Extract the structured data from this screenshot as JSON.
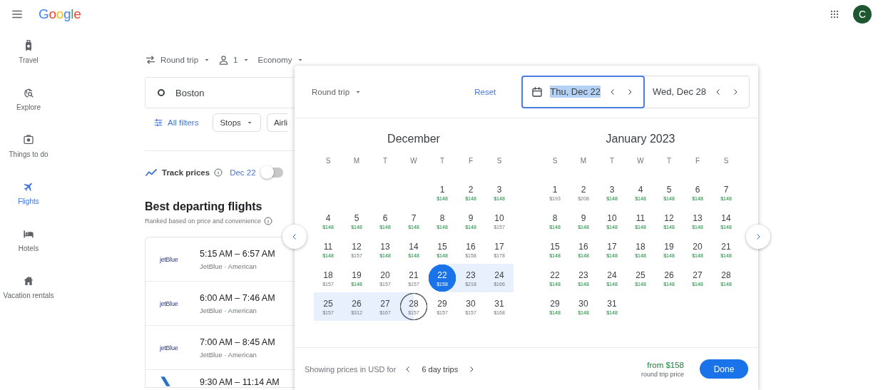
{
  "topbar": {
    "logo": "Google",
    "avatar": "C"
  },
  "sidebar": {
    "items": [
      {
        "label": "Travel",
        "selected": false
      },
      {
        "label": "Explore",
        "selected": false
      },
      {
        "label": "Things to do",
        "selected": false
      },
      {
        "label": "Flights",
        "selected": true
      },
      {
        "label": "Hotels",
        "selected": false
      },
      {
        "label": "Vacation rentals",
        "selected": false
      }
    ]
  },
  "search": {
    "trip_type": "Round trip",
    "passengers": "1",
    "cabin": "Economy",
    "origin": "Boston"
  },
  "filters": [
    {
      "label": "All filters",
      "kind": "link"
    },
    {
      "label": "Stops",
      "kind": "chip"
    },
    {
      "label": "Airli",
      "kind": "cut"
    }
  ],
  "track_prices": {
    "label": "Track prices",
    "date": "Dec 22",
    "on": false
  },
  "results": {
    "title": "Best departing flights",
    "subtitle": "Ranked based on price and convenience",
    "flights": [
      {
        "logo": {
          "kind": "wordmark",
          "text": "jetBlue"
        },
        "times": "5:15 AM – 6:57 AM",
        "airlines": "JetBlue · American"
      },
      {
        "logo": {
          "kind": "wordmark",
          "text": "jetBlue"
        },
        "times": "6:00 AM – 7:46 AM",
        "airlines": "JetBlue · American"
      },
      {
        "logo": {
          "kind": "wordmark",
          "text": "jetBlue"
        },
        "times": "7:00 AM – 8:45 AM",
        "airlines": "JetBlue · American"
      },
      {
        "logo": {
          "kind": "tail"
        },
        "times": "9:30 AM – 11:14 AM"
      }
    ]
  },
  "date_picker": {
    "trip_type": "Round trip",
    "reset": "Reset",
    "depart": {
      "value": "Thu, Dec 22",
      "focused": true
    },
    "return": {
      "value": "Wed, Dec 28",
      "focused": false
    },
    "months": [
      {
        "title": "December",
        "weekdays": [
          "S",
          "M",
          "T",
          "W",
          "T",
          "F",
          "S"
        ],
        "weeks": [
          {
            "kind": "lead",
            "days": [
              {
                "day": "1",
                "price": "$148",
                "cheap": true,
                "kind": "plain"
              },
              {
                "day": "2",
                "price": "$148",
                "cheap": true,
                "kind": "plain"
              },
              {
                "day": "3",
                "price": "$148",
                "cheap": true,
                "kind": "plain"
              }
            ]
          },
          {
            "kind": "full",
            "days": [
              {
                "day": "4",
                "price": "$148",
                "cheap": true,
                "kind": "plain"
              },
              {
                "day": "5",
                "price": "$148",
                "cheap": true,
                "kind": "plain"
              },
              {
                "day": "6",
                "price": "$148",
                "cheap": true,
                "kind": "plain"
              },
              {
                "day": "7",
                "price": "$148",
                "cheap": true,
                "kind": "plain"
              },
              {
                "day": "8",
                "price": "$148",
                "cheap": true,
                "kind": "plain"
              },
              {
                "day": "9",
                "price": "$148",
                "cheap": true,
                "kind": "plain"
              },
              {
                "day": "10",
                "price": "$157",
                "cheap": false,
                "kind": "plain"
              }
            ]
          },
          {
            "kind": "full",
            "days": [
              {
                "day": "11",
                "price": "$148",
                "cheap": true,
                "kind": "plain"
              },
              {
                "day": "12",
                "price": "$157",
                "cheap": false,
                "kind": "plain"
              },
              {
                "day": "13",
                "price": "$148",
                "cheap": true,
                "kind": "plain"
              },
              {
                "day": "14",
                "price": "$148",
                "cheap": true,
                "kind": "plain"
              },
              {
                "day": "15",
                "price": "$148",
                "cheap": true,
                "kind": "plain"
              },
              {
                "day": "16",
                "price": "$158",
                "cheap": false,
                "kind": "plain"
              },
              {
                "day": "17",
                "price": "$178",
                "cheap": false,
                "kind": "plain"
              }
            ]
          },
          {
            "kind": "full",
            "days": [
              {
                "day": "18",
                "price": "$157",
                "cheap": false,
                "kind": "plain"
              },
              {
                "day": "19",
                "price": "$148",
                "cheap": true,
                "kind": "plain"
              },
              {
                "day": "20",
                "price": "$157",
                "cheap": false,
                "kind": "plain"
              },
              {
                "day": "21",
                "price": "$157",
                "cheap": false,
                "kind": "plain"
              },
              {
                "day": "22",
                "price": "$158",
                "cheap": false,
                "kind": "depart"
              },
              {
                "day": "23",
                "price": "$218",
                "cheap": false,
                "kind": "in-range"
              },
              {
                "day": "24",
                "price": "$166",
                "cheap": false,
                "kind": "in-range"
              }
            ]
          },
          {
            "kind": "full",
            "days": [
              {
                "day": "25",
                "price": "$157",
                "cheap": false,
                "kind": "in-range"
              },
              {
                "day": "26",
                "price": "$312",
                "cheap": false,
                "kind": "in-range"
              },
              {
                "day": "27",
                "price": "$167",
                "cheap": false,
                "kind": "in-range"
              },
              {
                "day": "28",
                "price": "$157",
                "cheap": false,
                "kind": "return"
              },
              {
                "day": "29",
                "price": "$157",
                "cheap": false,
                "kind": "plain"
              },
              {
                "day": "30",
                "price": "$157",
                "cheap": false,
                "kind": "plain"
              },
              {
                "day": "31",
                "price": "$168",
                "cheap": false,
                "kind": "plain"
              }
            ]
          }
        ]
      },
      {
        "title": "January 2023",
        "weekdays": [
          "S",
          "M",
          "T",
          "W",
          "T",
          "F",
          "S"
        ],
        "weeks": [
          {
            "kind": "full",
            "days": [
              {
                "day": "1",
                "price": "$193",
                "cheap": false,
                "kind": "plain"
              },
              {
                "day": "2",
                "price": "$208",
                "cheap": false,
                "kind": "plain"
              },
              {
                "day": "3",
                "price": "$148",
                "cheap": true,
                "kind": "plain"
              },
              {
                "day": "4",
                "price": "$148",
                "cheap": true,
                "kind": "plain"
              },
              {
                "day": "5",
                "price": "$148",
                "cheap": true,
                "kind": "plain"
              },
              {
                "day": "6",
                "price": "$148",
                "cheap": true,
                "kind": "plain"
              },
              {
                "day": "7",
                "price": "$148",
                "cheap": true,
                "kind": "plain"
              }
            ]
          },
          {
            "kind": "full",
            "days": [
              {
                "day": "8",
                "price": "$148",
                "cheap": true,
                "kind": "plain"
              },
              {
                "day": "9",
                "price": "$148",
                "cheap": true,
                "kind": "plain"
              },
              {
                "day": "10",
                "price": "$148",
                "cheap": true,
                "kind": "plain"
              },
              {
                "day": "11",
                "price": "$148",
                "cheap": true,
                "kind": "plain"
              },
              {
                "day": "12",
                "price": "$148",
                "cheap": true,
                "kind": "plain"
              },
              {
                "day": "13",
                "price": "$148",
                "cheap": true,
                "kind": "plain"
              },
              {
                "day": "14",
                "price": "$148",
                "cheap": true,
                "kind": "plain"
              }
            ]
          },
          {
            "kind": "full",
            "days": [
              {
                "day": "15",
                "price": "$148",
                "cheap": true,
                "kind": "plain"
              },
              {
                "day": "16",
                "price": "$148",
                "cheap": true,
                "kind": "plain"
              },
              {
                "day": "17",
                "price": "$148",
                "cheap": true,
                "kind": "plain"
              },
              {
                "day": "18",
                "price": "$148",
                "cheap": true,
                "kind": "plain"
              },
              {
                "day": "19",
                "price": "$148",
                "cheap": true,
                "kind": "plain"
              },
              {
                "day": "20",
                "price": "$148",
                "cheap": true,
                "kind": "plain"
              },
              {
                "day": "21",
                "price": "$148",
                "cheap": true,
                "kind": "plain"
              }
            ]
          },
          {
            "kind": "full",
            "days": [
              {
                "day": "22",
                "price": "$148",
                "cheap": true,
                "kind": "plain"
              },
              {
                "day": "23",
                "price": "$148",
                "cheap": true,
                "kind": "plain"
              },
              {
                "day": "24",
                "price": "$148",
                "cheap": true,
                "kind": "plain"
              },
              {
                "day": "25",
                "price": "$148",
                "cheap": true,
                "kind": "plain"
              },
              {
                "day": "26",
                "price": "$148",
                "cheap": true,
                "kind": "plain"
              },
              {
                "day": "27",
                "price": "$148",
                "cheap": true,
                "kind": "plain"
              },
              {
                "day": "28",
                "price": "$148",
                "cheap": true,
                "kind": "plain"
              }
            ]
          },
          {
            "kind": "trail",
            "days": [
              {
                "day": "29",
                "price": "$148",
                "cheap": true,
                "kind": "plain"
              },
              {
                "day": "30",
                "price": "$148",
                "cheap": true,
                "kind": "plain"
              },
              {
                "day": "31",
                "price": "$148",
                "cheap": true,
                "kind": "plain"
              }
            ]
          }
        ]
      }
    ],
    "footer": {
      "prefix": "Showing prices in USD for",
      "trip_length": "6 day trips",
      "price": "from $158",
      "price_note": "round trip price",
      "done": "Done"
    }
  }
}
